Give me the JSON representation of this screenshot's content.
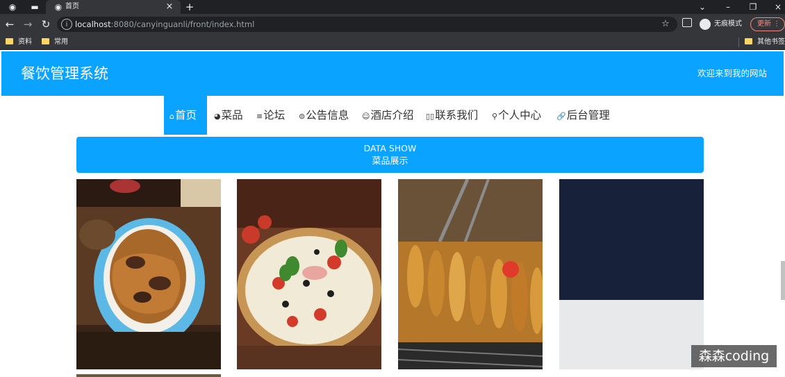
{
  "browser": {
    "tab_title": "首页",
    "url_host": "localhost",
    "url_path": ":8080/canyinguanli/front/index.html",
    "incognito_label": "无痕模式",
    "update_label": "更新",
    "bookmarks": [
      "资料",
      "常用"
    ],
    "other_bookmarks": "其他书签"
  },
  "site": {
    "title": "餐饮管理系统",
    "welcome": "欢迎来到我的网站"
  },
  "nav": {
    "items": [
      {
        "label": "首页",
        "icon": "home-icon",
        "active": true
      },
      {
        "label": "菜品",
        "icon": "dashboard-icon",
        "active": false
      },
      {
        "label": "论坛",
        "icon": "forum-icon",
        "active": false
      },
      {
        "label": "公告信息",
        "icon": "notice-icon",
        "active": false
      },
      {
        "label": "酒店介绍",
        "icon": "hotel-icon",
        "active": false
      },
      {
        "label": "联系我们",
        "icon": "contact-icon",
        "active": false
      },
      {
        "label": "个人中心",
        "icon": "user-icon",
        "active": false
      },
      {
        "label": "后台管理",
        "icon": "link-icon",
        "active": false
      }
    ]
  },
  "section": {
    "title_en": "DATA SHOW",
    "title_zh": "菜品展示"
  },
  "dishes": [
    {
      "name": "beef-noodles"
    },
    {
      "name": "pizza"
    },
    {
      "name": "grilled-skewers"
    },
    {
      "name": "dark-dish"
    }
  ],
  "watermark": "森森coding",
  "colors": {
    "accent": "#0aa3ff",
    "browser_dark": "#202124",
    "toolbar": "#35363a"
  }
}
